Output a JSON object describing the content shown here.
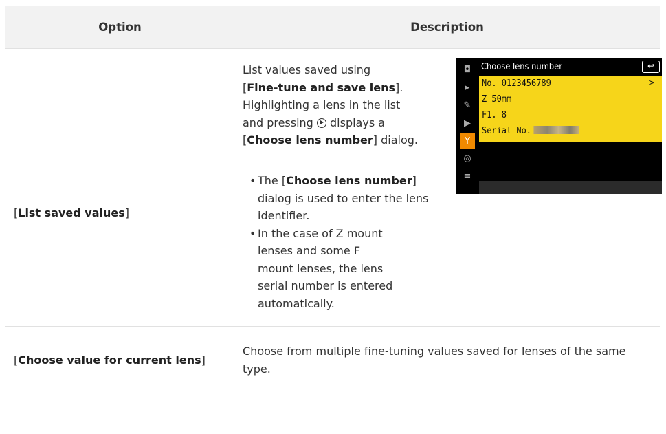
{
  "table": {
    "headers": {
      "option": "Option",
      "description": "Description"
    },
    "rows": [
      {
        "option": "List saved values",
        "description": {
          "p1": "List values saved using",
          "p1_bold": "Fine-tune and save lens",
          "p2": "Highlighting a lens in the list",
          "p3_a": "and pressing",
          "p3_b": "displays a",
          "p4_bold": "Choose lens number",
          "p4_end": "dialog.",
          "bullet1_pre": "The [",
          "bullet1_bold": "Choose lens number",
          "bullet1_post": "] dialog is used to enter the lens identifier.",
          "bullet2": "In the case of Z mount lenses and some F mount lenses, the lens serial number is entered automatically."
        }
      },
      {
        "option": "Choose value for current lens",
        "description": "Choose from multiple fine-tuning values saved for lenses of the same type."
      }
    ]
  },
  "camera_screen": {
    "title": "Choose lens number",
    "back_icon": "return-icon",
    "rows": [
      "No. 0123456789",
      "Z 50mm",
      "F1. 8",
      "Serial No."
    ],
    "row_arrow": ">",
    "side_icons": [
      "camera-icon",
      "movie-icon",
      "pencil-icon",
      "playback-icon",
      "wrench-icon",
      "network-icon",
      "my-menu-icon"
    ],
    "panel_color": "#f6d51a",
    "active_tab_color": "#f08a00"
  }
}
